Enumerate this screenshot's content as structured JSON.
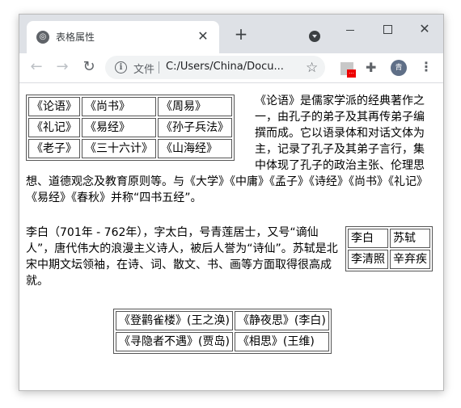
{
  "browser": {
    "tab_title": "表格属性",
    "tab_favicon": "globe-icon",
    "address": {
      "scheme_label": "文件",
      "url": "C:/Users/China/Docu..."
    },
    "profile_initial": "青"
  },
  "content": {
    "table1": [
      [
        "《论语》",
        "《尚书》",
        "《周易》"
      ],
      [
        "《礼记》",
        "《易经》",
        "《孙子兵法》"
      ],
      [
        "《老子》",
        "《三十六计》",
        "《山海经》"
      ]
    ],
    "paragraph1": "《论语》是儒家学派的经典著作之一，由孔子的弟子及其再传弟子编撰而成。它以语录体和对话文体为主，记录了孔子及其弟子言行，集中体现了孔子的政治主张、伦理思想、道德观念及教育原则等。与《大学》《中庸》《孟子》《诗经》《尚书》《礼记》《易经》《春秋》并称“四书五经”。",
    "table2": [
      [
        "李白",
        "苏轼"
      ],
      [
        "李清照",
        "辛弃疾"
      ]
    ],
    "paragraph2": "李白（701年 - 762年），字太白，号青莲居士，又号“谪仙人”，唐代伟大的浪漫主义诗人，被后人誉为“诗仙”。苏轼是北宋中期文坛领袖，在诗、词、散文、书、画等方面取得很高成就。",
    "table3": [
      [
        "《登鹳雀楼》(王之涣)",
        "《静夜思》(李白)"
      ],
      [
        "《寻隐者不遇》(贾岛)",
        "《相思》(王维)"
      ]
    ]
  }
}
